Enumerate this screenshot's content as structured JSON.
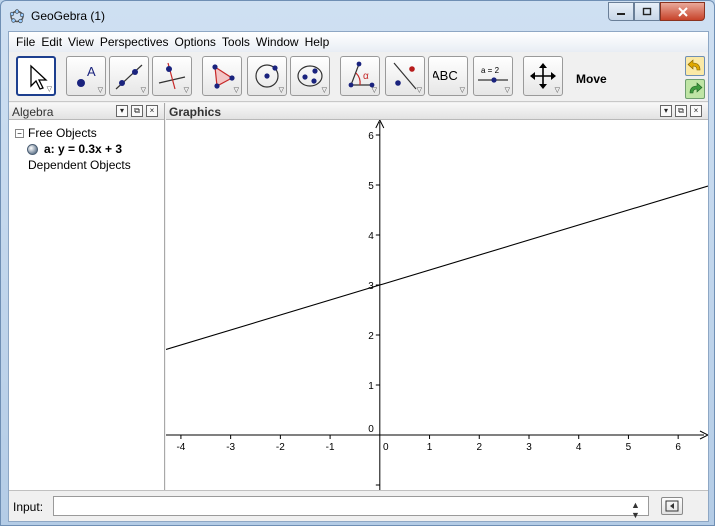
{
  "window": {
    "title": "GeoGebra (1)"
  },
  "menubar": {
    "items": [
      "File",
      "Edit",
      "View",
      "Perspectives",
      "Options",
      "Tools",
      "Window",
      "Help"
    ]
  },
  "toolbar": {
    "tools": [
      {
        "name": "move",
        "icon": "arrow-pointer-icon"
      },
      {
        "name": "new-point",
        "icon": "point-A-icon"
      },
      {
        "name": "line",
        "icon": "line-through-points-icon"
      },
      {
        "name": "perpendicular",
        "icon": "perpendicular-line-icon"
      },
      {
        "name": "polygon",
        "icon": "polygon-icon"
      },
      {
        "name": "circle-center-point",
        "icon": "circle-center-icon"
      },
      {
        "name": "conic-five-points",
        "icon": "ellipse-icon"
      },
      {
        "name": "angle",
        "icon": "angle-alpha-icon"
      },
      {
        "name": "reflect",
        "icon": "reflect-about-line-icon"
      },
      {
        "name": "text",
        "icon": "abc-text-icon",
        "label": "ABC"
      },
      {
        "name": "slider",
        "icon": "slider-icon",
        "label": "a = 2"
      },
      {
        "name": "move-graphics",
        "icon": "move-graphics-cross-icon"
      }
    ],
    "selected_tool_name": "Move"
  },
  "algebra": {
    "title": "Algebra",
    "free_objects_label": "Free Objects",
    "object_a": "a: y = 0.3x + 3",
    "dependent_objects_label": "Dependent Objects"
  },
  "graphics": {
    "title": "Graphics",
    "x_tick_labels": [
      "-4",
      "-3",
      "-2",
      "-1",
      "0",
      "1",
      "2",
      "3",
      "4",
      "5",
      "6"
    ],
    "y_tick_labels": [
      "1",
      "2",
      "3",
      "4",
      "5",
      "6"
    ],
    "origin_label": "0",
    "x_range": [
      -4.3,
      6.6
    ],
    "y_range": [
      -1.1,
      6.3
    ],
    "line": {
      "slope": 0.3,
      "intercept": 3,
      "color": "#000000"
    }
  },
  "inputbar": {
    "label": "Input:",
    "value": ""
  }
}
